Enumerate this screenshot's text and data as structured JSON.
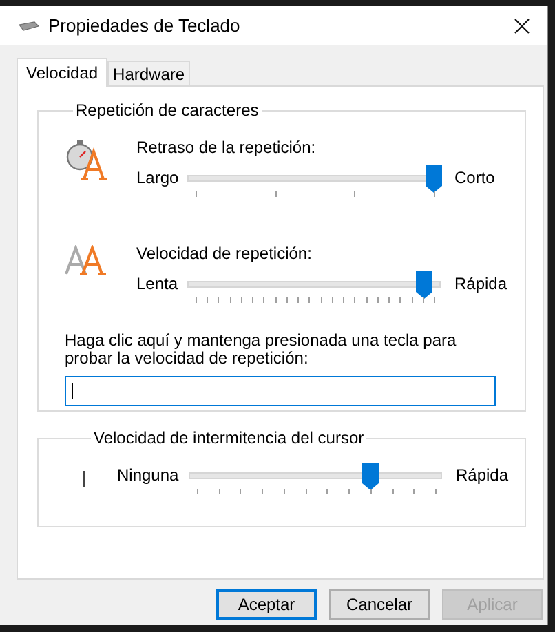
{
  "window": {
    "title": "Propiedades de Teclado"
  },
  "tabs": [
    {
      "label": "Velocidad",
      "selected": true
    },
    {
      "label": "Hardware",
      "selected": false
    }
  ],
  "character_repeat": {
    "title": "Repetición de caracteres",
    "sliders": [
      {
        "kind": "delay",
        "label": "Retraso de la repetición:",
        "min_label": "Largo",
        "max_label": "Corto",
        "level": 1.0
      },
      {
        "kind": "rate",
        "label": "Velocidad de repetición:",
        "min_label": "Lenta",
        "max_label": "Rápida",
        "level": 0.96
      }
    ],
    "test_prompt": "Haga clic aquí y mantenga presionada una tecla para probar la velocidad de repetición:"
  },
  "cursor_blink": {
    "title": "Velocidad de intermitencia del cursor",
    "min_label": "Ninguna",
    "max_label": "Rápida",
    "level": 0.73
  },
  "buttons": [
    {
      "label": "Aceptar",
      "default": true,
      "disabled": false
    },
    {
      "label": "Cancelar",
      "default": false,
      "disabled": false
    },
    {
      "label": "Aplicar",
      "default": false,
      "disabled": true
    }
  ]
}
